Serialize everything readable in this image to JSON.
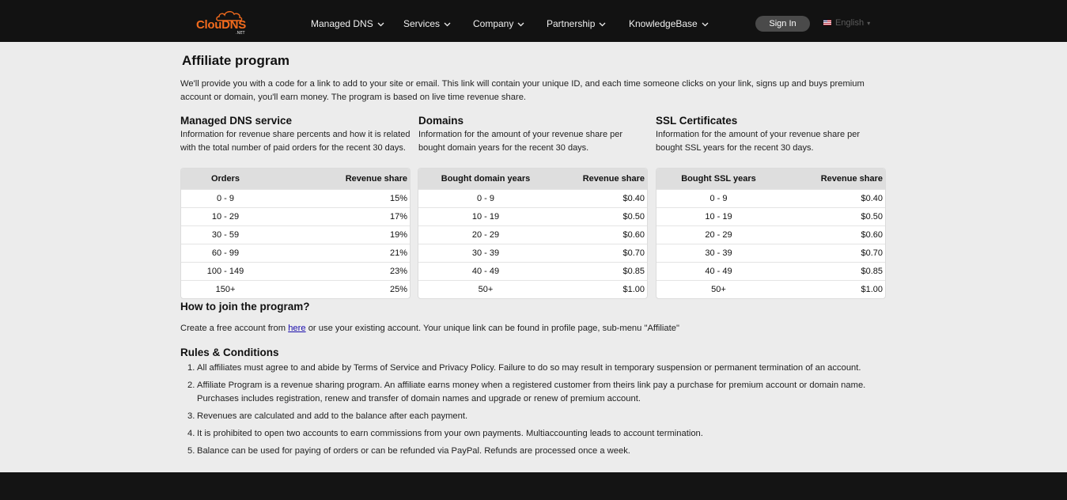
{
  "header": {
    "logo": {
      "name": "ClouDNS",
      "suffix": ".NET"
    },
    "nav": [
      {
        "label": "Managed DNS"
      },
      {
        "label": "Services"
      },
      {
        "label": "Company"
      },
      {
        "label": "Partnership"
      },
      {
        "label": "KnowledgeBase"
      }
    ],
    "signin_label": "Sign In",
    "language": "English",
    "colors": {
      "bar": "#121212",
      "brand": "#f26b1d"
    }
  },
  "main": {
    "title": "Affiliate program",
    "intro": "We'll provide you with a code for a link to add to your site or email. This link will contain your unique ID, and each time someone clicks on your link, signs up and buys premium account or domain, you'll earn money. The program is based on live time revenue share.",
    "sections": [
      {
        "title": "Managed DNS service",
        "description": "Information for revenue share percents and how it is related with the total number of paid orders for the recent 30 days.",
        "columns": [
          "Orders",
          "Revenue share"
        ],
        "rows": [
          [
            "0 - 9",
            "15%"
          ],
          [
            "10 - 29",
            "17%"
          ],
          [
            "30 - 59",
            "19%"
          ],
          [
            "60 - 99",
            "21%"
          ],
          [
            "100 - 149",
            "23%"
          ],
          [
            "150+",
            "25%"
          ]
        ]
      },
      {
        "title": "Domains",
        "description": "Information for the amount of your revenue share per bought domain years for the recent 30 days.",
        "columns": [
          "Bought domain years",
          "Revenue share"
        ],
        "rows": [
          [
            "0 - 9",
            "$0.40"
          ],
          [
            "10 - 19",
            "$0.50"
          ],
          [
            "20 - 29",
            "$0.60"
          ],
          [
            "30 - 39",
            "$0.70"
          ],
          [
            "40 - 49",
            "$0.85"
          ],
          [
            "50+",
            "$1.00"
          ]
        ]
      },
      {
        "title": "SSL Certificates",
        "description": "Information for the amount of your revenue share per bought SSL years for the recent 30 days.",
        "columns": [
          "Bought SSL years",
          "Revenue share"
        ],
        "rows": [
          [
            "0 - 9",
            "$0.40"
          ],
          [
            "10 - 19",
            "$0.50"
          ],
          [
            "20 - 29",
            "$0.60"
          ],
          [
            "30 - 39",
            "$0.70"
          ],
          [
            "40 - 49",
            "$0.85"
          ],
          [
            "50+",
            "$1.00"
          ]
        ]
      }
    ],
    "join": {
      "title": "How to join the program?",
      "text_before": "Create a free account from ",
      "link_text": "here",
      "text_after": " or use your existing account. Your unique link can be found in profile page, sub-menu \"Affiliate\""
    },
    "rules": {
      "title": "Rules & Conditions",
      "items": [
        "All affiliates must agree to and abide by Terms of Service and Privacy Policy. Failure to do so may result in temporary suspension or permanent termination of an account.",
        "Affiliate Program is a revenue sharing program. An affiliate earns money when a registered customer from theirs link pay a purchase for premium account or domain name. Purchases includes registration, renew and transfer of domain names and upgrade or renew of premium account.",
        "Revenues are calculated and add to the balance after each payment.",
        "It is prohibited to open two accounts to earn commissions from your own payments. Multiaccounting leads to account termination.",
        "Balance can be used for paying of orders or can be refunded via PayPal. Refunds are processed once a week."
      ]
    }
  }
}
